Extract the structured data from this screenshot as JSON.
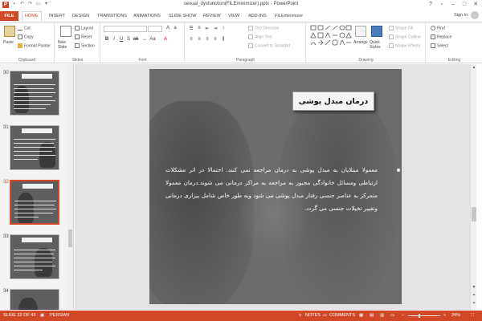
{
  "window": {
    "title": "sexual_dysfunction(FILEminimizer).pptx - PowerPoint",
    "controls": [
      "?",
      "▫",
      "–",
      "□",
      "✕"
    ]
  },
  "tabs": [
    "FILE",
    "HOME",
    "INSERT",
    "DESIGN",
    "TRANSITIONS",
    "ANIMATIONS",
    "SLIDE SHOW",
    "REVIEW",
    "VIEW",
    "ADD-INS",
    "FILEminimizer"
  ],
  "account": {
    "signin_label": "Sign in"
  },
  "ribbon": {
    "clipboard": {
      "paste": "Paste",
      "cut": "Cut",
      "copy": "Copy",
      "format_painter": "Format Painter",
      "label": "Clipboard"
    },
    "slides": {
      "new_slide": "New Slide",
      "layout": "Layout",
      "reset": "Reset",
      "section": "Section",
      "label": "Slides"
    },
    "font": {
      "label": "Font"
    },
    "paragraph": {
      "text_direction": "Text Direction",
      "align_text": "Align Text",
      "convert_smartart": "Convert to SmartArt",
      "label": "Paragraph"
    },
    "drawing": {
      "arrange": "Arrange",
      "quick_styles": "Quick Styles",
      "shape_fill": "Shape Fill",
      "shape_outline": "Shape Outline",
      "shape_effects": "Shape Effects",
      "label": "Drawing"
    },
    "editing": {
      "find": "Find",
      "replace": "Replace",
      "select": "Select",
      "label": "Editing"
    }
  },
  "thumbnails": [
    {
      "number": "30",
      "title_visible": true,
      "lines": 7,
      "selected": false
    },
    {
      "number": "31",
      "title_visible": true,
      "lines": 6,
      "selected": false
    },
    {
      "number": "32",
      "title_visible": true,
      "lines": 6,
      "selected": true
    },
    {
      "number": "33",
      "title_visible": true,
      "lines": 6,
      "selected": false
    },
    {
      "number": "34",
      "title_visible": false,
      "lines": 0,
      "selected": false
    }
  ],
  "slide": {
    "title": "درمان مبدل پوشی",
    "body": "معمولا مبتلایان به مبدل پوشی به درمان مراجعه نمی کنند. احتمالا در اثر مشکلات ارتباطی ومسائل خانوادگی مجبور به مراجعه به مراکز درمانی می شوند.درمان معمولا متمرکز به عناصر جنسی رفتار مبدل پوشی می شود وبه طور خاص شامل بیزاری درمانی وتغییر تخیلات جنسی می گردد."
  },
  "status": {
    "slide_counter": "SLIDE 32 OF 43",
    "language": "PERSIAN",
    "notes": "NOTES",
    "comments": "COMMENTS",
    "zoom": "34%"
  },
  "colors": {
    "accent": "#d24726",
    "slide_bg": "#6b6b6b"
  }
}
